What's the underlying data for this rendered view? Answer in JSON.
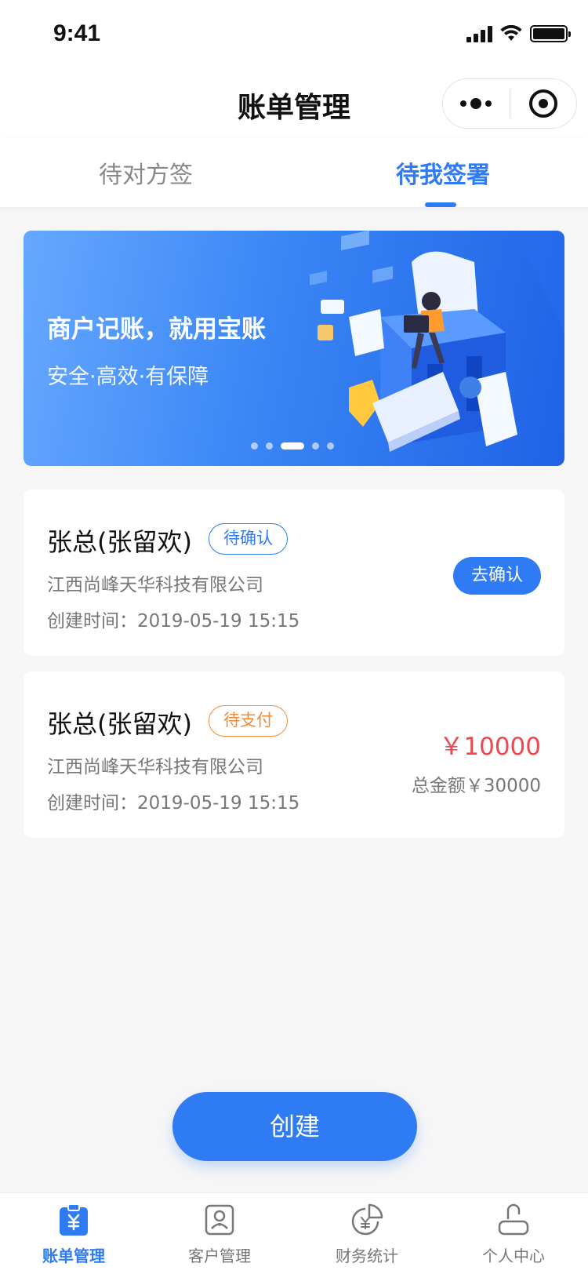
{
  "status_bar": {
    "time": "9:41"
  },
  "header": {
    "title": "账单管理"
  },
  "tabs": [
    {
      "label": "待对方签",
      "active": false
    },
    {
      "label": "待我签署",
      "active": true
    }
  ],
  "banner": {
    "headline": "商户记账，就用宝账",
    "subline": "安全·高效·有保障",
    "slides_total": 5,
    "active_slide": 3
  },
  "bills": [
    {
      "name": "张总(张留欢)",
      "status": "待确认",
      "company": "江西尚峰天华科技有限公司",
      "created": "创建时间：2019-05-19 15:15",
      "action": "去确认"
    },
    {
      "name": "张总(张留欢)",
      "status": "待支付",
      "company": "江西尚峰天华科技有限公司",
      "created": "创建时间：2019-05-19 15:15",
      "amount": "￥10000",
      "total": "总金额￥30000"
    }
  ],
  "create_button": {
    "label": "创建"
  },
  "tabbar": [
    {
      "label": "账单管理",
      "icon": "bill-icon",
      "active": true
    },
    {
      "label": "客户管理",
      "icon": "customer-icon",
      "active": false
    },
    {
      "label": "财务统计",
      "icon": "finance-stats-icon",
      "active": false
    },
    {
      "label": "个人中心",
      "icon": "user-icon",
      "active": false
    }
  ],
  "colors": {
    "primary": "#2f7bf3",
    "danger": "#f0464f",
    "warning": "#f08a3a"
  }
}
